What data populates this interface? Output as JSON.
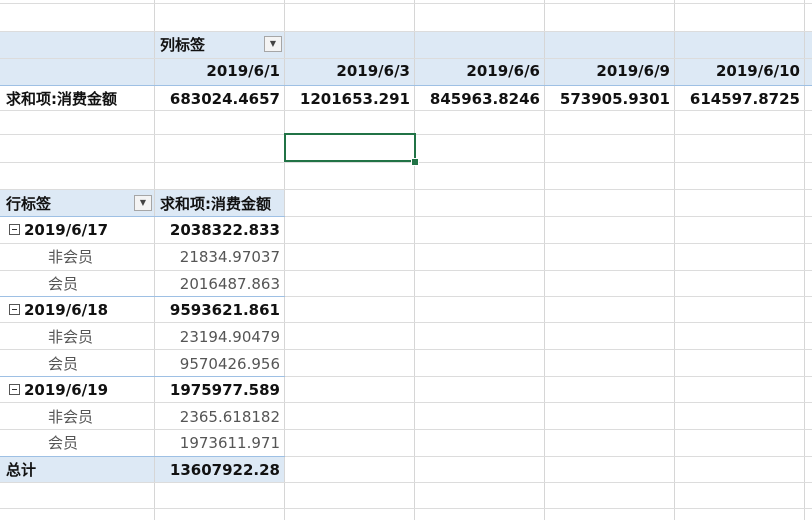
{
  "pivot_top": {
    "column_label": "列标签",
    "columns": [
      "2019/6/1",
      "2019/6/3",
      "2019/6/6",
      "2019/6/9",
      "2019/6/10"
    ],
    "row_label": "求和项:消费金额",
    "values": [
      "683024.4657",
      "1201653.291",
      "845963.8246",
      "573905.9301",
      "614597.8725"
    ]
  },
  "pivot_bottom": {
    "row_label_header": "行标签",
    "value_header": "求和项:消费金额",
    "groups": [
      {
        "date": "2019/6/17",
        "total": "2038322.833",
        "items": [
          {
            "label": "非会员",
            "value": "21834.97037"
          },
          {
            "label": "会员",
            "value": "2016487.863"
          }
        ]
      },
      {
        "date": "2019/6/18",
        "total": "9593621.861",
        "items": [
          {
            "label": "非会员",
            "value": "23194.90479"
          },
          {
            "label": "会员",
            "value": "9570426.956"
          }
        ]
      },
      {
        "date": "2019/6/19",
        "total": "1975977.589",
        "items": [
          {
            "label": "非会员",
            "value": "2365.618182"
          },
          {
            "label": "会员",
            "value": "1973611.971"
          }
        ]
      }
    ],
    "grand_total_label": "总计",
    "grand_total": "13607922.28"
  }
}
